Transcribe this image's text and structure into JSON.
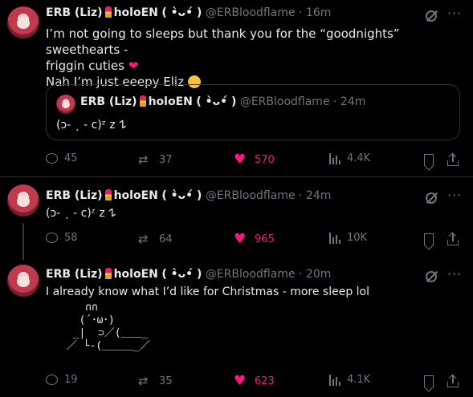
{
  "author": {
    "name": "ERB (Liz)",
    "org": "holoEN",
    "face": "( •̀ᴗ•́ )",
    "handle": "@ERBloodflame"
  },
  "icons": {
    "grok": "grok-icon",
    "more": "more-icon",
    "reply": "reply-icon",
    "repost": "repost-icon",
    "like": "heart-icon",
    "views": "views-icon",
    "bookmark": "bookmark-icon",
    "share": "share-icon"
  },
  "colors": {
    "like": "#f91880",
    "muted": "#71767b",
    "text": "#e7e9ea",
    "bg": "#000000"
  },
  "tweets": [
    {
      "time": "16m",
      "text_line1": "I’m not going to sleeps but thank you for the “goodnights” sweethearts -",
      "text_line2": "friggin cuties",
      "text_line3": "Nah I’m just eeepy Eliz",
      "quote": {
        "time": "24m",
        "text": "(ↄ- ͺ - c)ᶻ z 𐰁"
      },
      "stats": {
        "replies": "45",
        "reposts": "37",
        "likes": "570",
        "views": "4.4K"
      }
    },
    {
      "time": "24m",
      "text": "(ↄ- ͺ - c)ᶻ z 𐰁",
      "stats": {
        "replies": "58",
        "reposts": "64",
        "likes": "965",
        "views": "10K"
      }
    },
    {
      "time": "20m",
      "text": "I already know what I’d like for Christmas - more sleep lol",
      "ascii": "    ∩∩\n   (´･ω･)\n  _|  ⊃／(＿＿_\n ／ └-(＿＿＿_／",
      "stats": {
        "replies": "19",
        "reposts": "35",
        "likes": "623",
        "views": "4.1K"
      }
    }
  ],
  "separator": "·"
}
